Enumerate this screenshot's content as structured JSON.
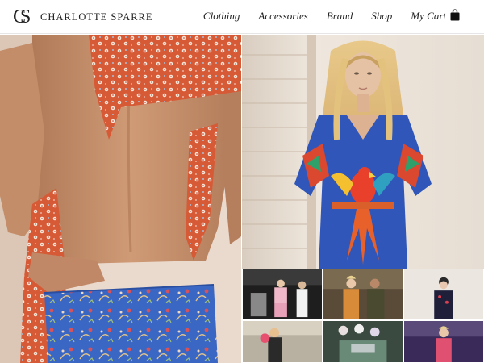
{
  "brand": {
    "monogram_c": "C",
    "monogram_s": "S",
    "name": "CHARLOTTE SPARRE"
  },
  "nav": {
    "items": [
      {
        "label": "Clothing"
      },
      {
        "label": "Accessories"
      },
      {
        "label": "Brand"
      },
      {
        "label": "Shop"
      }
    ],
    "cart_label": "My Cart",
    "cart_icon": "shopping-bag-icon"
  },
  "colors": {
    "text": "#222222",
    "dress_blue": "#2f56b8",
    "scarf_orange": "#d9603a"
  }
}
